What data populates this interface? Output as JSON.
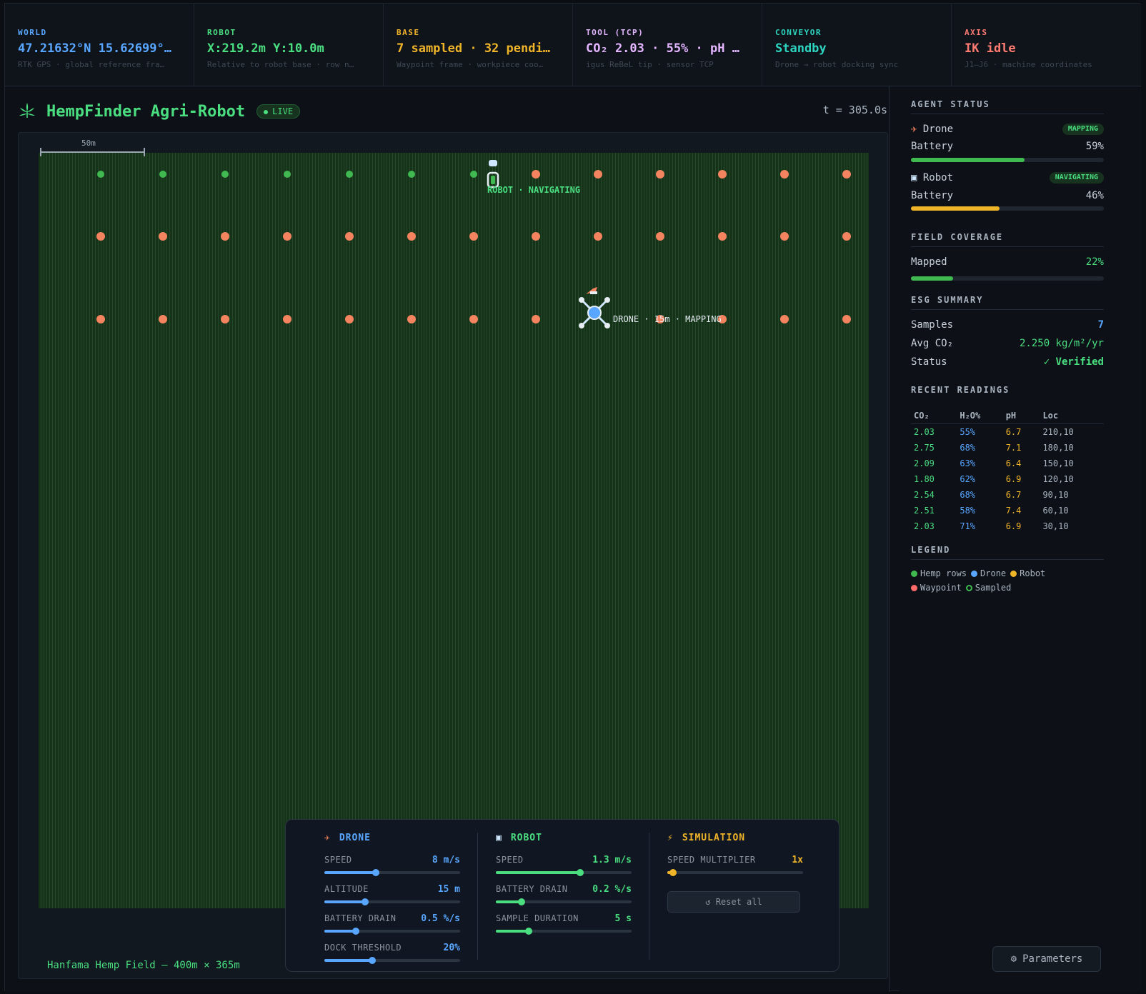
{
  "topbar": [
    {
      "label": "WORLD",
      "value": "47.21632°N 15.62699°…",
      "sub": "RTK GPS · global reference fra…",
      "color": "#58a6ff"
    },
    {
      "label": "ROBOT",
      "value": "X:219.2m Y:10.0m",
      "sub": "Relative to robot base · row n…",
      "color": "#4ade80"
    },
    {
      "label": "BASE",
      "value": "7 sampled · 32 pendi…",
      "sub": "Waypoint frame · workpiece coo…",
      "color": "#f0b429"
    },
    {
      "label": "TOOL (TCP)",
      "value": "CO₂ 2.03 · 55% · pH …",
      "sub": "igus ReBeL tip · sensor TCP",
      "color": "#e3b5ff"
    },
    {
      "label": "CONVEYOR",
      "value": "Standby",
      "sub": "Drone → robot docking sync",
      "color": "#2dd4bf"
    },
    {
      "label": "AXIS",
      "value": "IK idle",
      "sub": "J1–J6 · machine coordinates",
      "color": "#ff7b72"
    }
  ],
  "header": {
    "title": "HempFinder Agri-Robot",
    "live": "LIVE",
    "time": "t = 305.0s"
  },
  "field": {
    "scale_label": "50m",
    "caption": "Hanfama Hemp Field — 400m × 365m",
    "robot_label": "ROBOT · NAVIGATING",
    "drone_label": "DRONE · 15m · MAPPING"
  },
  "controls": {
    "drone": {
      "title": "DRONE",
      "sliders": [
        {
          "name": "SPEED",
          "value": "8 m/s",
          "level": 0.38
        },
        {
          "name": "ALTITUDE",
          "value": "15 m",
          "level": 0.3
        },
        {
          "name": "BATTERY DRAIN",
          "value": "0.5 %/s",
          "level": 0.23
        },
        {
          "name": "DOCK THRESHOLD",
          "value": "20%",
          "level": 0.35
        }
      ]
    },
    "robot": {
      "title": "ROBOT",
      "sliders": [
        {
          "name": "SPEED",
          "value": "1.3 m/s",
          "level": 0.62
        },
        {
          "name": "BATTERY DRAIN",
          "value": "0.2 %/s",
          "level": 0.19
        },
        {
          "name": "SAMPLE DURATION",
          "value": "5 s",
          "level": 0.24
        }
      ]
    },
    "simulation": {
      "title": "SIMULATION",
      "sliders": [
        {
          "name": "SPEED MULTIPLIER",
          "value": "1x",
          "level": 0.04
        }
      ],
      "reset": "↺ Reset all"
    }
  },
  "side": {
    "agent_status_title": "AGENT STATUS",
    "drone_name": "Drone",
    "drone_badge": "MAPPING",
    "drone_battery_label": "Battery",
    "drone_battery": "59%",
    "drone_battery_level": 0.59,
    "robot_name": "Robot",
    "robot_badge": "NAVIGATING",
    "robot_battery_label": "Battery",
    "robot_battery": "46%",
    "robot_battery_level": 0.46,
    "coverage_title": "FIELD COVERAGE",
    "mapped_label": "Mapped",
    "mapped": "22%",
    "mapped_level": 0.22,
    "esg_title": "ESG SUMMARY",
    "samples_label": "Samples",
    "samples": "7",
    "avg_label": "Avg CO₂",
    "avg": "2.250 kg/m²/yr",
    "status_label": "Status",
    "status": "✓ Verified",
    "readings_title": "RECENT READINGS",
    "readings_headers": [
      "CO₂",
      "H₂O%",
      "pH",
      "Loc"
    ],
    "readings": [
      [
        "2.03",
        "55%",
        "6.7",
        "210,10"
      ],
      [
        "2.75",
        "68%",
        "7.1",
        "180,10"
      ],
      [
        "2.09",
        "63%",
        "6.4",
        "150,10"
      ],
      [
        "1.80",
        "62%",
        "6.9",
        "120,10"
      ],
      [
        "2.54",
        "68%",
        "6.7",
        "90,10"
      ],
      [
        "2.51",
        "58%",
        "7.4",
        "60,10"
      ],
      [
        "2.03",
        "71%",
        "6.9",
        "30,10"
      ]
    ],
    "legend_title": "LEGEND",
    "legend": [
      {
        "label": "Hemp rows",
        "color": "#3fb950"
      },
      {
        "label": "Drone",
        "color": "#58a6ff"
      },
      {
        "label": "Robot",
        "color": "#f0b429"
      },
      {
        "label": "Waypoint",
        "color": "#ff6b6b"
      },
      {
        "label": "Sampled",
        "color": "#3fb950"
      }
    ],
    "params_label": "Parameters"
  }
}
